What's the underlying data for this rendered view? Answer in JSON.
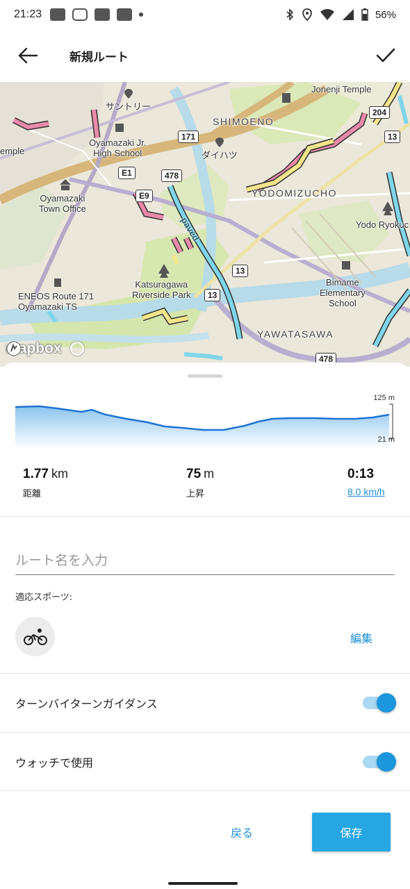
{
  "status_bar": {
    "time": "21:23",
    "battery": "56%",
    "icons": [
      "bluetooth-icon",
      "location-icon",
      "wifi-icon",
      "signal-icon",
      "battery-icon"
    ]
  },
  "header": {
    "title": "新規ルート",
    "back_icon": "arrow-left-icon",
    "confirm_icon": "checkmark-icon"
  },
  "map": {
    "labels": {
      "suntory": "サントリー",
      "jonenji": "Jonenji Temple",
      "temple_edge": "emple",
      "shimoeno": "SHIMOENO",
      "oyamazaki_jr_high": "Oyamazaki Jr.\nHigh School",
      "daihatsu": "ダイハツ",
      "oyamazaki_town_office": "Oyamazaki\nTown Office",
      "yodomizucho": "YODOMIZUCHO",
      "yodo_ryokuchi": "Yodo Ryokuc",
      "paved": "paved",
      "katsuragawa": "Katsuragawa\nRiverside Park",
      "bimame": "Bimame\nElementary\nSchool",
      "eneos": "ENEOS Route 171\nOyamazaki TS",
      "yawatasawa": "YAWATASAWA",
      "mapbox": "mapbox"
    },
    "shields": {
      "r171": "171",
      "r204": "204",
      "r13a": "13",
      "e1": "E1",
      "r478a": "478",
      "e9": "E9",
      "r13b": "13",
      "r13c": "13",
      "r478b": "478"
    }
  },
  "elevation": {
    "max_label": "125 m",
    "min_label": "21 m"
  },
  "stats": {
    "distance": {
      "value": "1.77",
      "unit": "km",
      "label": "距離"
    },
    "ascent": {
      "value": "75",
      "unit": "m",
      "label": "上昇"
    },
    "duration": {
      "value": "0:13",
      "speed": "8.0 km/h"
    }
  },
  "form": {
    "route_name_placeholder": "ルート名を入力",
    "sports_label": "適応スポーツ:",
    "sport_icon": "bicycle-icon",
    "edit_label": "編集"
  },
  "toggles": [
    {
      "label": "ターンバイターンガイダンス",
      "on": true
    },
    {
      "label": "ウォッチで使用",
      "on": true
    }
  ],
  "actions": {
    "back_label": "戻る",
    "save_label": "保存"
  },
  "colors": {
    "accent": "#1c8fd6",
    "save_button": "#26a7e3",
    "toggle_on": "#1c96dc",
    "route_cyan": "#7fd6ea",
    "route_pink": "#e88aa8",
    "route_yellow": "#f3e58a"
  }
}
